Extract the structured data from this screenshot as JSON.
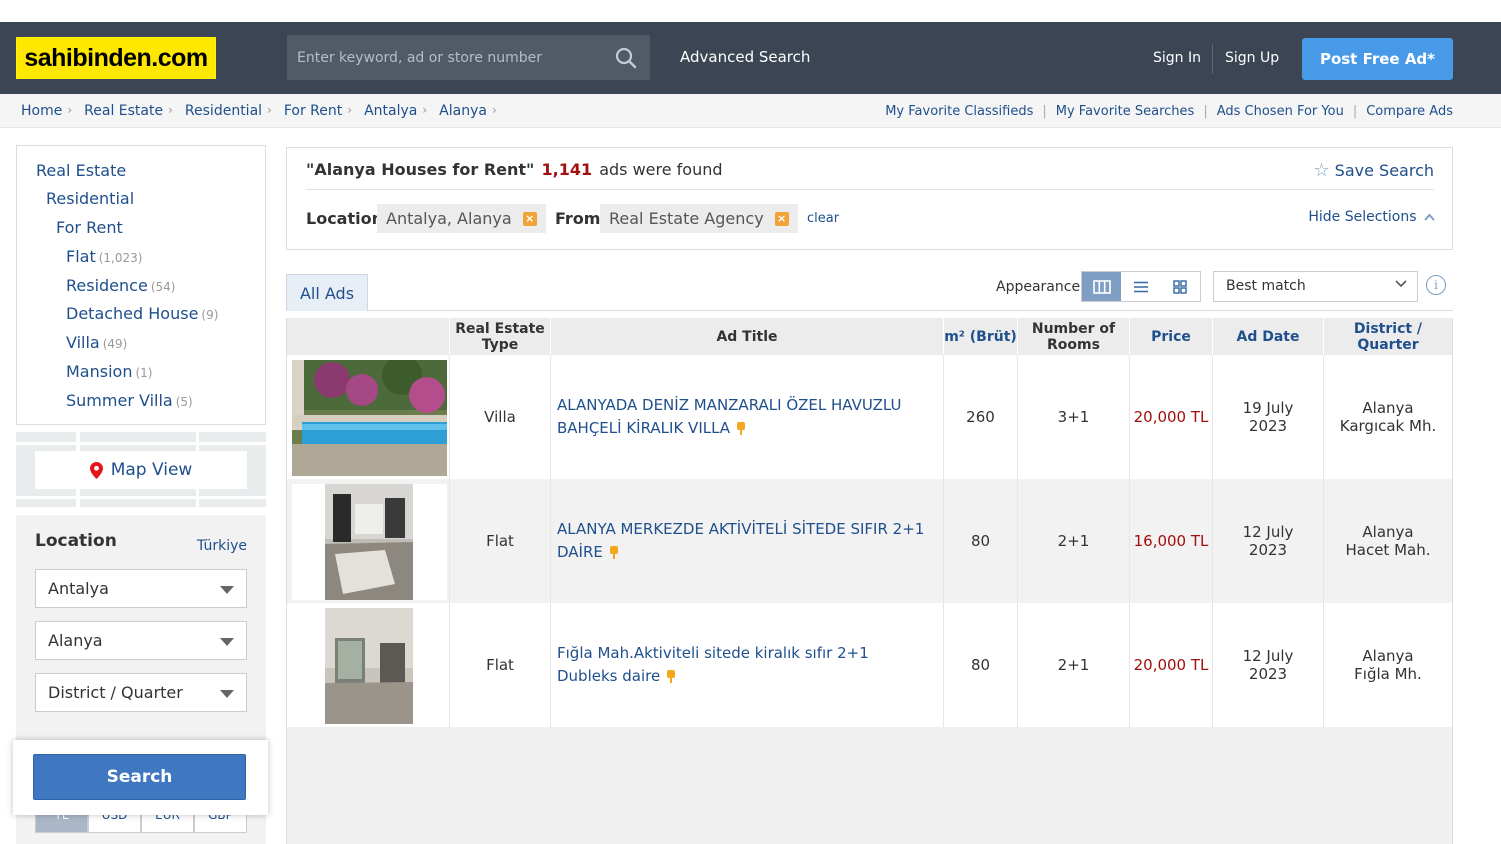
{
  "header": {
    "logo": "sahibinden.com",
    "search_placeholder": "Enter keyword, ad or store number",
    "advanced_search": "Advanced Search",
    "sign_in": "Sign In",
    "sign_up": "Sign Up",
    "post_ad": "Post Free Ad*"
  },
  "breadcrumb": [
    "Home",
    "Real Estate",
    "Residential",
    "For Rent",
    "Antalya",
    "Alanya"
  ],
  "top_links": [
    "My Favorite Classifieds",
    "My Favorite Searches",
    "Ads Chosen For You",
    "Compare Ads"
  ],
  "categories": {
    "l1": "Real Estate",
    "l2": "Residential",
    "l3": "For Rent",
    "items": [
      {
        "label": "Flat",
        "count": "(1,023)"
      },
      {
        "label": "Residence",
        "count": "(54)"
      },
      {
        "label": "Detached House",
        "count": "(9)"
      },
      {
        "label": "Villa",
        "count": "(49)"
      },
      {
        "label": "Mansion",
        "count": "(1)"
      },
      {
        "label": "Summer Villa",
        "count": "(5)"
      }
    ]
  },
  "map_view": "Map View",
  "location": {
    "title": "Location",
    "country": "Türkiye",
    "city": "Antalya",
    "district": "Alanya",
    "quarter_placeholder": "District / Quarter"
  },
  "currency": [
    "TL",
    "USD",
    "EUR",
    "GBP"
  ],
  "search_button": "Search",
  "summary": {
    "query": "\"Alanya Houses for Rent\"",
    "count": "1,141",
    "suffix": "ads were found",
    "save_search": "Save Search",
    "location_label": "Location",
    "location_chip": "Antalya, Alanya",
    "from_label": "From",
    "from_chip": "Real Estate Agency",
    "clear": "clear",
    "hide_selections": "Hide Selections"
  },
  "tabs": {
    "all_ads": "All Ads",
    "appearance": "Appearance",
    "sort": "Best match"
  },
  "table": {
    "headers": [
      "Real Estate Type",
      "Ad Title",
      "m² (Brüt)",
      "Number of Rooms",
      "Price",
      "Ad Date",
      "District / Quarter"
    ],
    "rows": [
      {
        "type": "Villa",
        "title": "ALANYADA DENİZ MANZARALI ÖZEL HAVUZLU BAHÇELİ KİRALIK VILLA",
        "m2": "260",
        "rooms": "3+1",
        "price": "20,000 TL",
        "date1": "19 July",
        "date2": "2023",
        "district": "Alanya",
        "quarter": "Kargıcak Mh."
      },
      {
        "type": "Flat",
        "title": "ALANYA MERKEZDE AKTİVİTELİ SİTEDE SIFIR 2+1 DAİRE",
        "m2": "80",
        "rooms": "2+1",
        "price": "16,000 TL",
        "date1": "12 July",
        "date2": "2023",
        "district": "Alanya",
        "quarter": "Hacet Mah."
      },
      {
        "type": "Flat",
        "title": "Fığla Mah.Aktiviteli sitede kiralık sıfır 2+1 Dubleks daire",
        "m2": "80",
        "rooms": "2+1",
        "price": "20,000 TL",
        "date1": "12 July",
        "date2": "2023",
        "district": "Alanya",
        "quarter": "Fığla Mh."
      }
    ]
  },
  "colors": {
    "header_bg": "#3b4554",
    "logo_bg": "#ffe800",
    "post_ad_bg": "#489ae9",
    "link": "#1f4f8c",
    "price": "#a30e0e",
    "search_btn": "#3f77c0"
  }
}
